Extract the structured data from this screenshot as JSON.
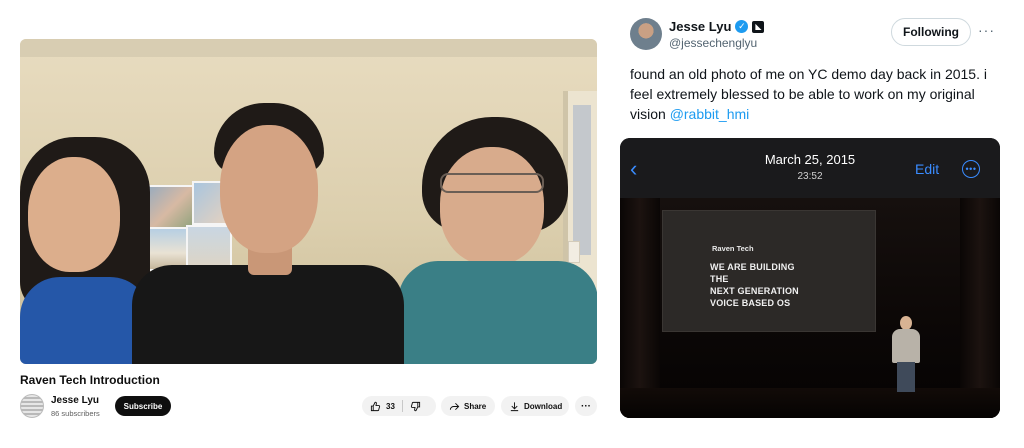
{
  "video": {
    "title": "Raven Tech Introduction",
    "channel_name": "Jesse Lyu",
    "subscribers": "86 subscribers",
    "subscribe_label": "Subscribe",
    "like_count": "33",
    "share_label": "Share",
    "download_label": "Download",
    "more_label": "···"
  },
  "tweet": {
    "author_name": "Jesse Lyu",
    "handle": "@jessechenglyu",
    "follow_label": "Following",
    "more_label": "···",
    "text": "found an old photo of me on YC demo day back in 2015. i feel extremely blessed to be able to work on my original vision ",
    "mention": "@rabbit_hmi",
    "embed": {
      "date": "March 25, 2015",
      "time": "23:52",
      "edit_label": "Edit",
      "slide_brand": "Raven Tech",
      "slide_lines": [
        "WE ARE BUILDING",
        "THE",
        "NEXT GENERATION",
        "VOICE BASED OS"
      ]
    }
  },
  "icons": {
    "verified": "verified-check-icon",
    "affiliate": "affiliate-badge-icon",
    "like": "thumbs-up-icon",
    "dislike": "thumbs-down-icon",
    "share": "share-arrow-icon",
    "download": "download-icon",
    "back": "chevron-left-icon",
    "more": "more-circle-icon"
  },
  "colors": {
    "twitter_blue": "#1d9bf0",
    "ios_blue": "#3a8cff",
    "subscribe_bg": "#0f0f0f"
  }
}
